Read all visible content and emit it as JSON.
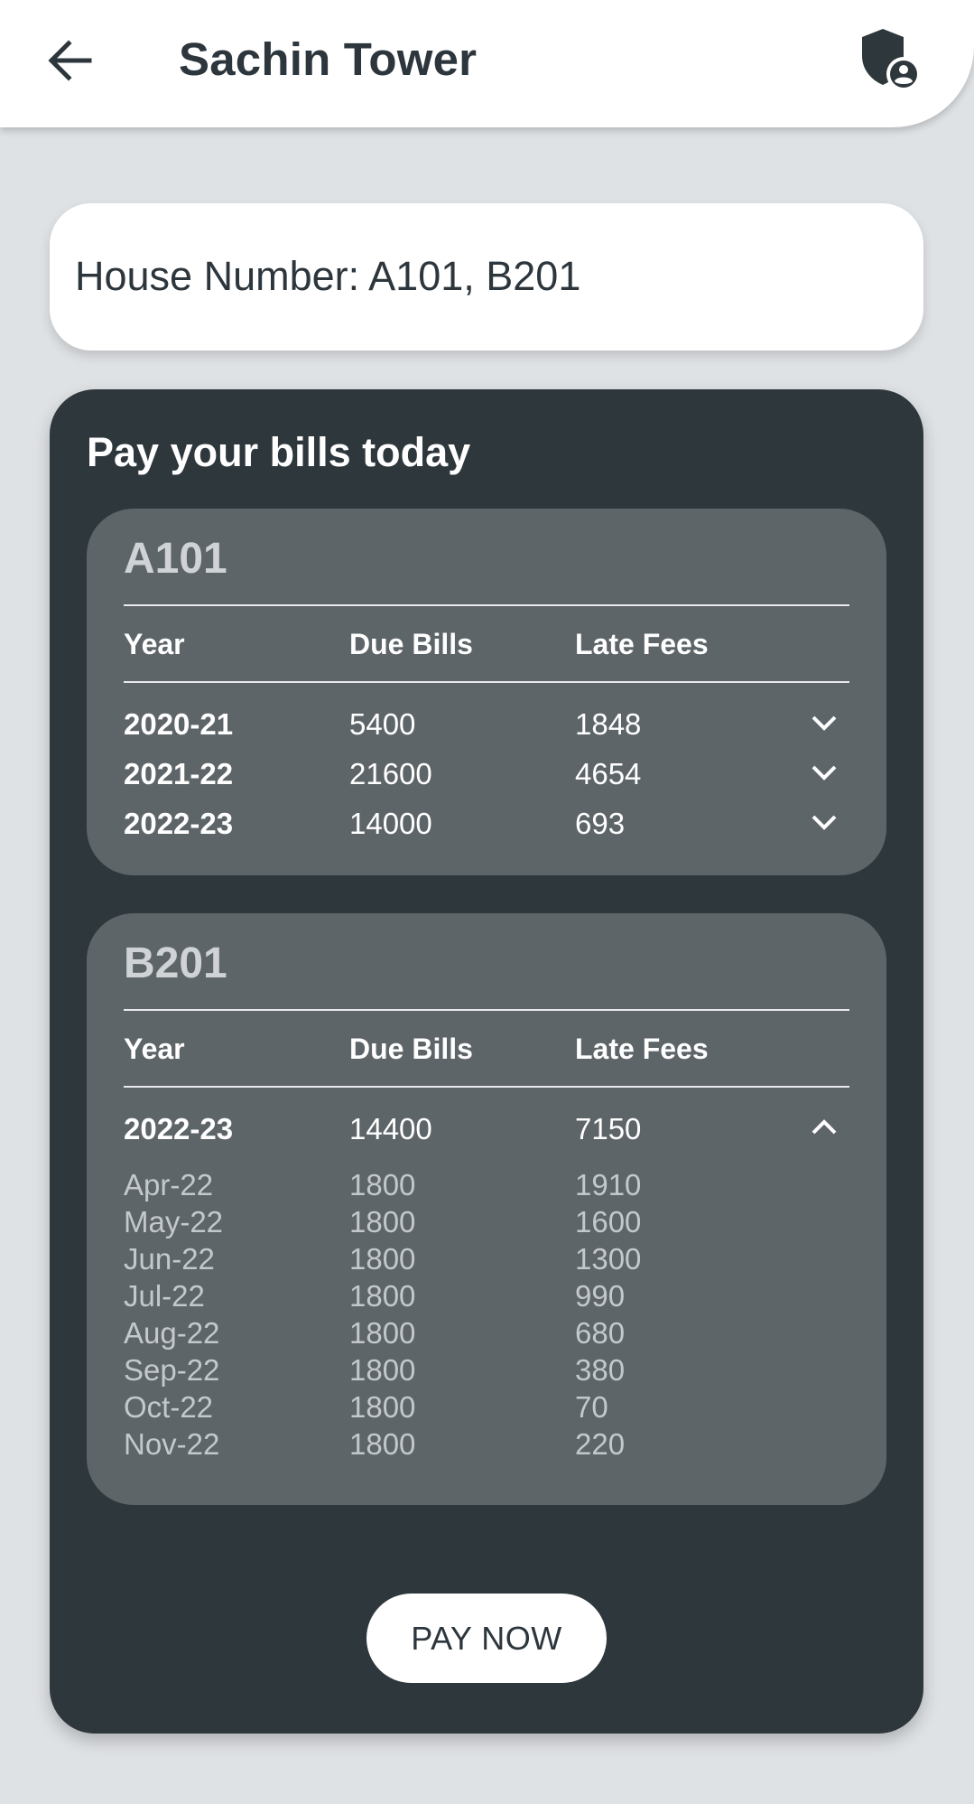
{
  "appbar": {
    "title": "Sachin Tower",
    "back_icon": "arrow-left-icon",
    "profile_icon": "shield-user-icon"
  },
  "house_card": {
    "text": "House Number: A101, B201"
  },
  "bills": {
    "title": "Pay your bills today",
    "columns": {
      "year": "Year",
      "due": "Due Bills",
      "late": "Late Fees"
    },
    "houses": [
      {
        "name": "A101",
        "rows": [
          {
            "year": "2020-21",
            "due": "5400",
            "late": "1848",
            "expanded": false
          },
          {
            "year": "2021-22",
            "due": "21600",
            "late": "4654",
            "expanded": false
          },
          {
            "year": "2022-23",
            "due": "14000",
            "late": "693",
            "expanded": false
          }
        ]
      },
      {
        "name": "B201",
        "rows": [
          {
            "year": "2022-23",
            "due": "14400",
            "late": "7150",
            "expanded": true,
            "months": [
              {
                "month": "Apr-22",
                "due": "1800",
                "late": "1910"
              },
              {
                "month": "May-22",
                "due": "1800",
                "late": "1600"
              },
              {
                "month": "Jun-22",
                "due": "1800",
                "late": "1300"
              },
              {
                "month": "Jul-22",
                "due": "1800",
                "late": "990"
              },
              {
                "month": "Aug-22",
                "due": "1800",
                "late": "680"
              },
              {
                "month": "Sep-22",
                "due": "1800",
                "late": "380"
              },
              {
                "month": "Oct-22",
                "due": "1800",
                "late": "70"
              },
              {
                "month": "Nov-22",
                "due": "1800",
                "late": "220"
              }
            ]
          }
        ]
      }
    ],
    "pay_button": "PAY NOW"
  }
}
